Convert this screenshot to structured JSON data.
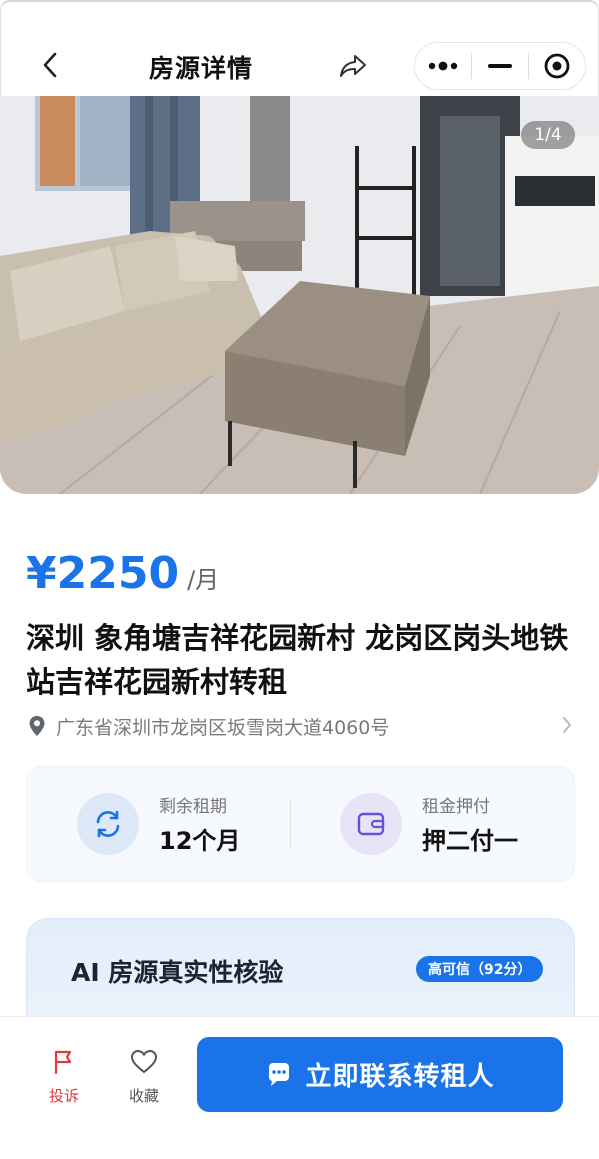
{
  "header": {
    "title": "房源详情",
    "back_icon": "chevron-left-icon",
    "share_icon": "share-icon",
    "capsule": {
      "more_icon": "more-dots-icon",
      "minimize_icon": "minimize-icon",
      "close_icon": "target-icon"
    }
  },
  "photo": {
    "counter": "1/4"
  },
  "listing": {
    "price": "¥2250",
    "price_unit": "/月",
    "title": "深圳 象角塘吉祥花园新村 龙岗区岗头地铁站吉祥花园新村转租",
    "address": "广东省深圳市龙岗区坂雪岗大道4060号"
  },
  "lease": {
    "remaining_label": "剩余租期",
    "remaining_value": "12个月",
    "deposit_label": "租金押付",
    "deposit_value": "押二付一"
  },
  "ai_check": {
    "title": "AI 房源真实性核验",
    "badge": "高可信（92分）"
  },
  "bottom_bar": {
    "report_label": "投诉",
    "favorite_label": "收藏",
    "contact_label": "立即联系转租人"
  },
  "colors": {
    "accent": "#1a73e8",
    "report_red": "#e0393e",
    "muted": "#777777"
  }
}
